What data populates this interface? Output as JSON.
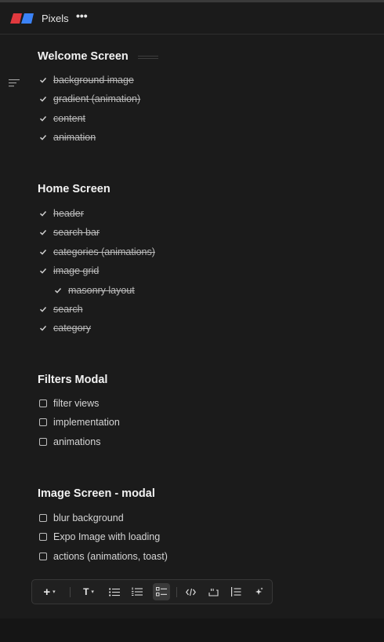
{
  "app": {
    "title": "Pixels",
    "more_label": "•••"
  },
  "sections": [
    {
      "title": "Welcome Screen",
      "items": [
        {
          "label": "background image",
          "done": true
        },
        {
          "label": "gradient (animation)",
          "done": true
        },
        {
          "label": "content",
          "done": true
        },
        {
          "label": "animation",
          "done": true
        }
      ]
    },
    {
      "title": "Home Screen",
      "items": [
        {
          "label": "header",
          "done": true
        },
        {
          "label": "search bar",
          "done": true
        },
        {
          "label": "categories (animations)",
          "done": true
        },
        {
          "label": "image grid",
          "done": true
        },
        {
          "label": "masonry layout",
          "done": true,
          "indent": 1
        },
        {
          "label": "search",
          "done": true
        },
        {
          "label": "category",
          "done": true
        }
      ]
    },
    {
      "title": "Filters Modal",
      "items": [
        {
          "label": "filter views",
          "done": false
        },
        {
          "label": "implementation",
          "done": false
        },
        {
          "label": "animations",
          "done": false
        }
      ]
    },
    {
      "title": "Image Screen - modal",
      "items": [
        {
          "label": "blur background",
          "done": false
        },
        {
          "label": "Expo Image with loading",
          "done": false
        },
        {
          "label": "actions (animations, toast)",
          "done": false
        }
      ]
    }
  ],
  "toolbar": {
    "add_label": "+",
    "text_label": "T",
    "caret": "▾",
    "buttons": [
      {
        "name": "add",
        "icon": "plus-icon"
      },
      {
        "name": "text-style",
        "icon": "text-icon"
      },
      {
        "name": "bullet-list",
        "icon": "bullet-list-icon"
      },
      {
        "name": "numbered-list",
        "icon": "numbered-list-icon"
      },
      {
        "name": "checklist",
        "icon": "checklist-icon",
        "active": true
      },
      {
        "name": "code",
        "icon": "code-icon"
      },
      {
        "name": "quote",
        "icon": "quote-icon"
      },
      {
        "name": "indent",
        "icon": "indent-icon"
      },
      {
        "name": "ai",
        "icon": "sparkle-icon"
      }
    ]
  },
  "colors": {
    "background": "#1b1b1b",
    "logo_red": "#e0393e",
    "logo_blue": "#3b82f6"
  }
}
